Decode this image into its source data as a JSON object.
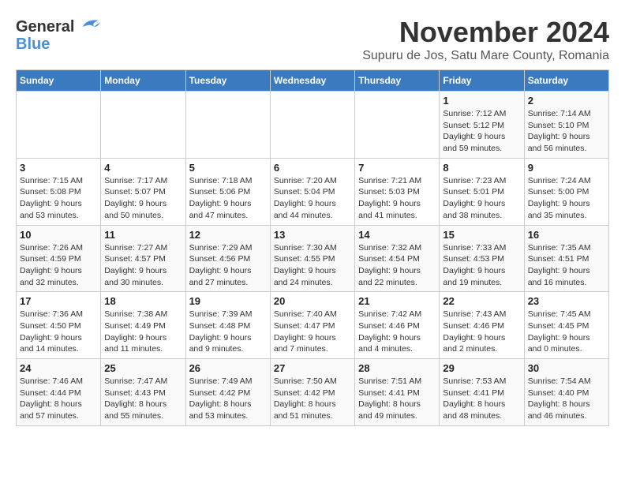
{
  "logo": {
    "line1": "General",
    "line2": "Blue"
  },
  "title": "November 2024",
  "subtitle": "Supuru de Jos, Satu Mare County, Romania",
  "days_of_week": [
    "Sunday",
    "Monday",
    "Tuesday",
    "Wednesday",
    "Thursday",
    "Friday",
    "Saturday"
  ],
  "weeks": [
    [
      {
        "day": "",
        "info": ""
      },
      {
        "day": "",
        "info": ""
      },
      {
        "day": "",
        "info": ""
      },
      {
        "day": "",
        "info": ""
      },
      {
        "day": "",
        "info": ""
      },
      {
        "day": "1",
        "info": "Sunrise: 7:12 AM\nSunset: 5:12 PM\nDaylight: 9 hours and 59 minutes."
      },
      {
        "day": "2",
        "info": "Sunrise: 7:14 AM\nSunset: 5:10 PM\nDaylight: 9 hours and 56 minutes."
      }
    ],
    [
      {
        "day": "3",
        "info": "Sunrise: 7:15 AM\nSunset: 5:08 PM\nDaylight: 9 hours and 53 minutes."
      },
      {
        "day": "4",
        "info": "Sunrise: 7:17 AM\nSunset: 5:07 PM\nDaylight: 9 hours and 50 minutes."
      },
      {
        "day": "5",
        "info": "Sunrise: 7:18 AM\nSunset: 5:06 PM\nDaylight: 9 hours and 47 minutes."
      },
      {
        "day": "6",
        "info": "Sunrise: 7:20 AM\nSunset: 5:04 PM\nDaylight: 9 hours and 44 minutes."
      },
      {
        "day": "7",
        "info": "Sunrise: 7:21 AM\nSunset: 5:03 PM\nDaylight: 9 hours and 41 minutes."
      },
      {
        "day": "8",
        "info": "Sunrise: 7:23 AM\nSunset: 5:01 PM\nDaylight: 9 hours and 38 minutes."
      },
      {
        "day": "9",
        "info": "Sunrise: 7:24 AM\nSunset: 5:00 PM\nDaylight: 9 hours and 35 minutes."
      }
    ],
    [
      {
        "day": "10",
        "info": "Sunrise: 7:26 AM\nSunset: 4:59 PM\nDaylight: 9 hours and 32 minutes."
      },
      {
        "day": "11",
        "info": "Sunrise: 7:27 AM\nSunset: 4:57 PM\nDaylight: 9 hours and 30 minutes."
      },
      {
        "day": "12",
        "info": "Sunrise: 7:29 AM\nSunset: 4:56 PM\nDaylight: 9 hours and 27 minutes."
      },
      {
        "day": "13",
        "info": "Sunrise: 7:30 AM\nSunset: 4:55 PM\nDaylight: 9 hours and 24 minutes."
      },
      {
        "day": "14",
        "info": "Sunrise: 7:32 AM\nSunset: 4:54 PM\nDaylight: 9 hours and 22 minutes."
      },
      {
        "day": "15",
        "info": "Sunrise: 7:33 AM\nSunset: 4:53 PM\nDaylight: 9 hours and 19 minutes."
      },
      {
        "day": "16",
        "info": "Sunrise: 7:35 AM\nSunset: 4:51 PM\nDaylight: 9 hours and 16 minutes."
      }
    ],
    [
      {
        "day": "17",
        "info": "Sunrise: 7:36 AM\nSunset: 4:50 PM\nDaylight: 9 hours and 14 minutes."
      },
      {
        "day": "18",
        "info": "Sunrise: 7:38 AM\nSunset: 4:49 PM\nDaylight: 9 hours and 11 minutes."
      },
      {
        "day": "19",
        "info": "Sunrise: 7:39 AM\nSunset: 4:48 PM\nDaylight: 9 hours and 9 minutes."
      },
      {
        "day": "20",
        "info": "Sunrise: 7:40 AM\nSunset: 4:47 PM\nDaylight: 9 hours and 7 minutes."
      },
      {
        "day": "21",
        "info": "Sunrise: 7:42 AM\nSunset: 4:46 PM\nDaylight: 9 hours and 4 minutes."
      },
      {
        "day": "22",
        "info": "Sunrise: 7:43 AM\nSunset: 4:46 PM\nDaylight: 9 hours and 2 minutes."
      },
      {
        "day": "23",
        "info": "Sunrise: 7:45 AM\nSunset: 4:45 PM\nDaylight: 9 hours and 0 minutes."
      }
    ],
    [
      {
        "day": "24",
        "info": "Sunrise: 7:46 AM\nSunset: 4:44 PM\nDaylight: 8 hours and 57 minutes."
      },
      {
        "day": "25",
        "info": "Sunrise: 7:47 AM\nSunset: 4:43 PM\nDaylight: 8 hours and 55 minutes."
      },
      {
        "day": "26",
        "info": "Sunrise: 7:49 AM\nSunset: 4:42 PM\nDaylight: 8 hours and 53 minutes."
      },
      {
        "day": "27",
        "info": "Sunrise: 7:50 AM\nSunset: 4:42 PM\nDaylight: 8 hours and 51 minutes."
      },
      {
        "day": "28",
        "info": "Sunrise: 7:51 AM\nSunset: 4:41 PM\nDaylight: 8 hours and 49 minutes."
      },
      {
        "day": "29",
        "info": "Sunrise: 7:53 AM\nSunset: 4:41 PM\nDaylight: 8 hours and 48 minutes."
      },
      {
        "day": "30",
        "info": "Sunrise: 7:54 AM\nSunset: 4:40 PM\nDaylight: 8 hours and 46 minutes."
      }
    ]
  ]
}
